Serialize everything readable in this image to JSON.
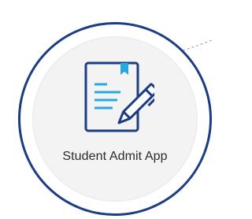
{
  "app_tile": {
    "label": "Student Admit App",
    "icon": "document-with-pen-icon"
  },
  "colors": {
    "ring": "#1c3d82",
    "icon_outline": "#1c3d82",
    "icon_accent": "#29a8e0",
    "inner_fill": "#f3f3f3"
  }
}
